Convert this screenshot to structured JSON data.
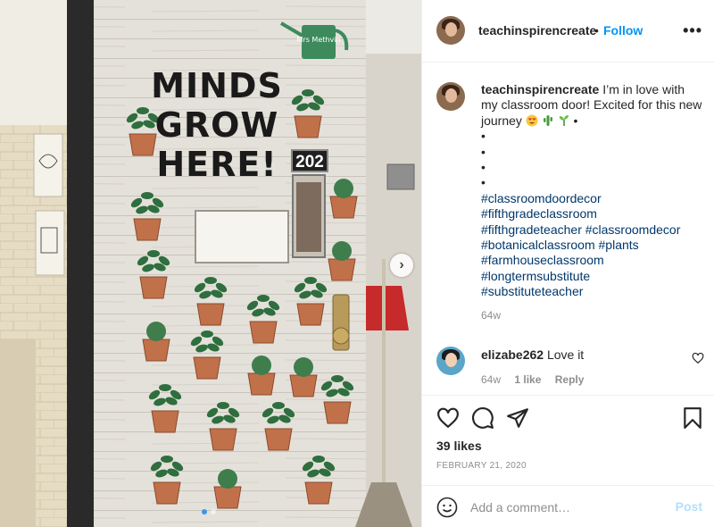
{
  "photo": {
    "door_title": [
      "MINDS",
      "GROW",
      "HERE!"
    ],
    "room_number": "202",
    "sign_text": "Mrs Methvin",
    "carousel_count": 2,
    "carousel_active_index": 0,
    "door_color": "#e3e0d8"
  },
  "header": {
    "username": "teachinspirencreate",
    "separator": "•",
    "follow_label": "Follow",
    "more_label": "•••"
  },
  "caption": {
    "username": "teachinspirencreate",
    "text": "I’m in love with my classroom door! Excited for this new journey",
    "text_after_emoji": "•",
    "bullets": [
      "•",
      "•",
      "•",
      "•"
    ],
    "hashtags_block": [
      "#classroomdoordecor",
      "#fifthgradeclassroom"
    ],
    "hashtag_line_pairs": [
      [
        "#fifthgradeteacher",
        "#classroomdecor"
      ],
      [
        "#botanicalclassroom",
        "#plants"
      ]
    ],
    "hashtags_tail": [
      "#farmhouseclassroom",
      "#longtermsubstitute",
      "#substituteteacher"
    ],
    "time": "64w"
  },
  "comment": {
    "username": "elizabe262",
    "text": "Love it",
    "time": "64w",
    "likes": "1 like",
    "reply_label": "Reply"
  },
  "actions": {
    "likes": "39 likes",
    "date": "FEBRUARY 21, 2020"
  },
  "add_comment": {
    "placeholder": "Add a comment…",
    "post_label": "Post"
  },
  "colors": {
    "link": "#0095f6",
    "hashtag": "#00376b",
    "muted": "#8e8e8e",
    "post_disabled": "#b2dffc"
  }
}
